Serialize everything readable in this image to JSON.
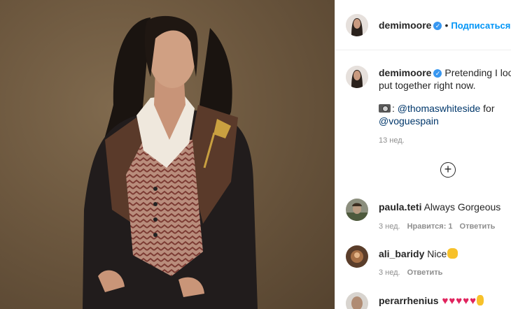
{
  "post": {
    "author": "demimoore",
    "follow_separator": "•",
    "follow_label": "Подписаться",
    "caption": {
      "line1": "Pretending I loo",
      "line2": "put together right now.",
      "credit_prefix": ":",
      "credit_handle1": "@thomaswhiteside",
      "credit_for": "for",
      "credit_handle2": "@voguespain"
    },
    "time": "13 нед.",
    "load_more_icon": "plus-circle-icon"
  },
  "comments": [
    {
      "user": "paula.teti",
      "text": "Always Gorgeous",
      "time": "3 нед.",
      "likes": "Нравится: 1",
      "reply": "Ответить"
    },
    {
      "user": "ali_baridy",
      "text": "Nice",
      "time": "3 нед.",
      "reply": "Ответить"
    },
    {
      "user": "perarrhenius",
      "text": ""
    }
  ],
  "colors": {
    "accent": "#0095f6",
    "verified": "#3897f0",
    "link": "#00376b",
    "heart": "#e0245e"
  }
}
